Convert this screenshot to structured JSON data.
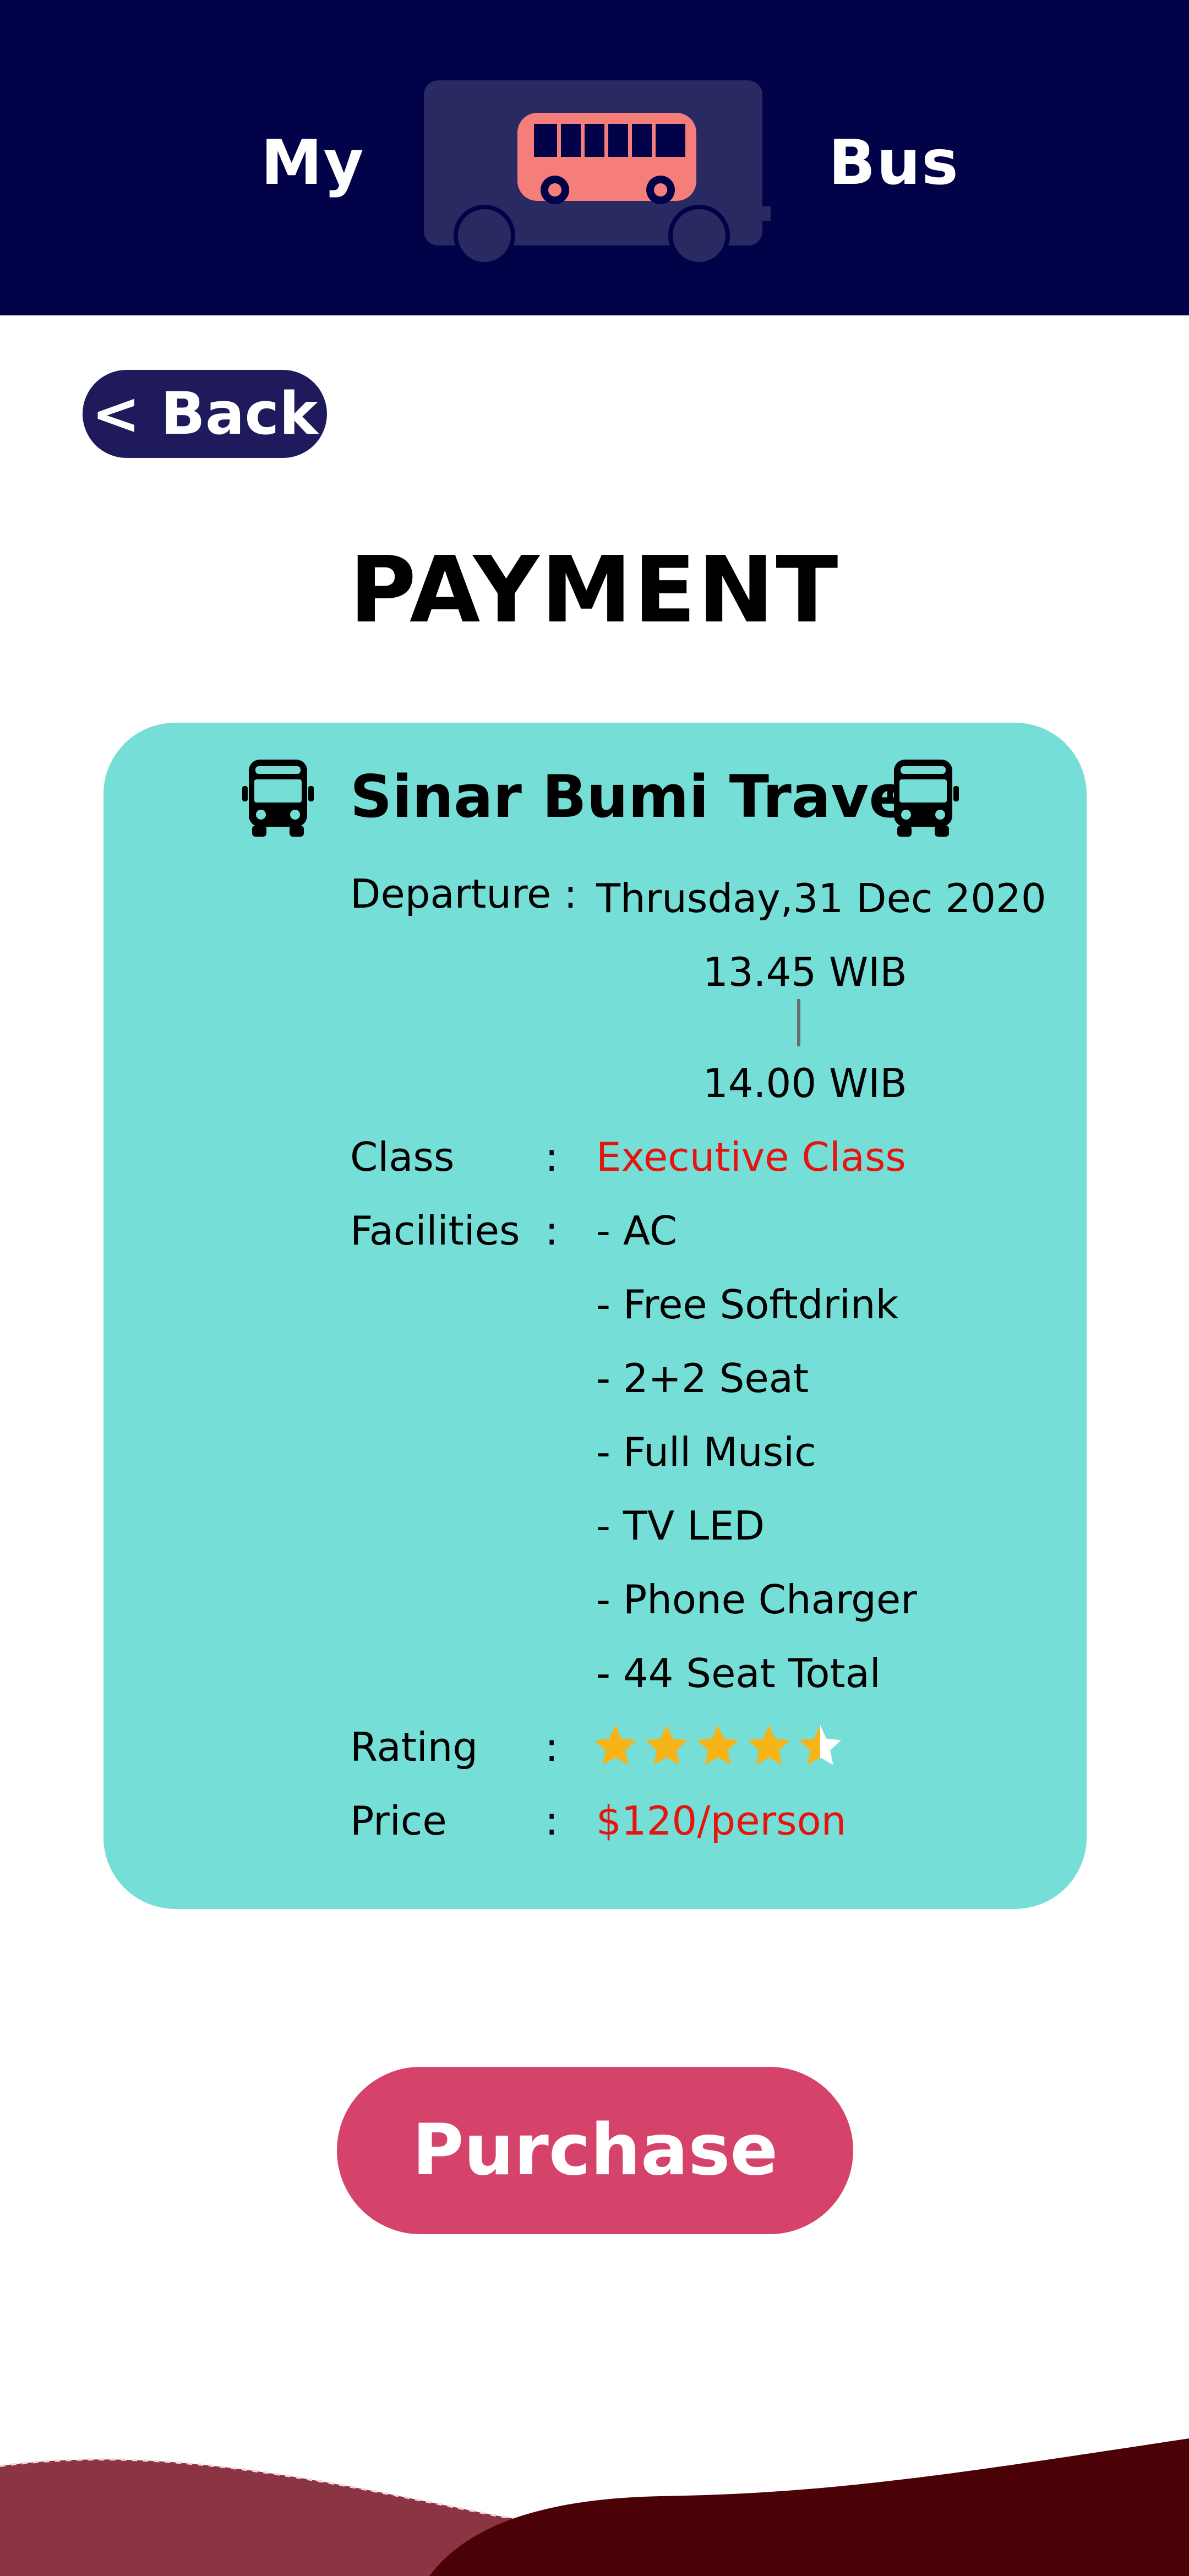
{
  "app": {
    "logo_left": "My",
    "logo_right": "Bus"
  },
  "nav": {
    "back_label": "< Back"
  },
  "page": {
    "title": "PAYMENT"
  },
  "ticket": {
    "company": "Sinar Bumi Travel",
    "departure": {
      "label": "Departure :",
      "date": "Thrusday,31 Dec 2020",
      "time_start": "13.45 WIB",
      "time_end": "14.00 WIB"
    },
    "class": {
      "label": "Class",
      "colon": ":",
      "value": "Executive Class"
    },
    "facilities": {
      "label": "Facilities",
      "colon": ":",
      "items": [
        "- AC",
        "- Free Softdrink",
        "- 2+2 Seat",
        "- Full Music",
        "- TV LED",
        "- Phone Charger",
        "- 44 Seat Total"
      ]
    },
    "rating": {
      "label": "Rating",
      "colon": ":",
      "value": 4.5,
      "max": 5
    },
    "price": {
      "label": "Price",
      "colon": ":",
      "value": "$120/person"
    }
  },
  "actions": {
    "purchase_label": "Purchase"
  },
  "icons": {
    "logo": "bus-icon",
    "card_left": "bus-front-icon",
    "card_right": "bus-front-icon",
    "rating": "star-icon"
  },
  "colors": {
    "header_bg": "#020249",
    "card_bg": "#75ded6",
    "accent_red": "#e6140f",
    "purchase_bg": "#d5426a",
    "back_bg": "#1f1a5c",
    "star": "#f6b418",
    "wave_dark": "#4a0206",
    "wave_mid": "#8b3443"
  }
}
